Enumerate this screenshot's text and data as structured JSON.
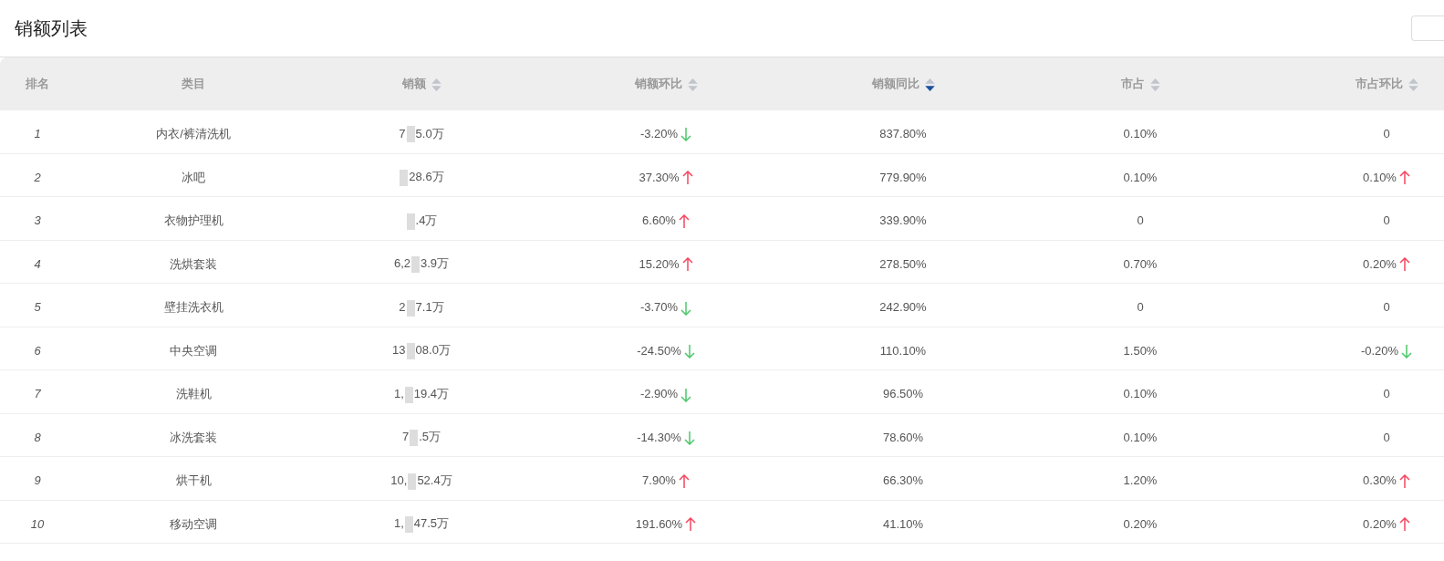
{
  "title": "销额列表",
  "columns": [
    {
      "label": "排名",
      "kind": "plain"
    },
    {
      "label": "类目",
      "kind": "plain"
    },
    {
      "label": "销额",
      "kind": "sortable",
      "sorted": false
    },
    {
      "label": "销额环比",
      "kind": "sortable",
      "sorted": false
    },
    {
      "label": "销额同比",
      "kind": "sortable",
      "sorted": true
    },
    {
      "label": "市占",
      "kind": "sortable",
      "sorted": false
    },
    {
      "label": "市占环比",
      "kind": "sortable",
      "sorted": false
    }
  ],
  "rows": [
    {
      "rank": "1",
      "category": "内衣/裤清洗机",
      "sales_before": "7",
      "sales_after": "5.0万",
      "mom": {
        "text": "-3.20%",
        "kind": "down"
      },
      "yoy": "837.80%",
      "share": "0.10%",
      "share_mom": {
        "text": "0",
        "kind": "plain"
      }
    },
    {
      "rank": "2",
      "category": "冰吧",
      "sales_after": "28.6万",
      "mom": {
        "text": "37.30%",
        "kind": "up"
      },
      "yoy": "779.90%",
      "share": "0.10%",
      "share_mom": {
        "text": "0.10%",
        "kind": "up"
      }
    },
    {
      "rank": "3",
      "category": "衣物护理机",
      "sales_after": ".4万",
      "mom": {
        "text": "6.60%",
        "kind": "up"
      },
      "yoy": "339.90%",
      "share": "0",
      "share_mom": {
        "text": "0",
        "kind": "plain"
      }
    },
    {
      "rank": "4",
      "category": "洗烘套装",
      "sales_before": "6,2",
      "sales_after": "3.9万",
      "mom": {
        "text": "15.20%",
        "kind": "up"
      },
      "yoy": "278.50%",
      "share": "0.70%",
      "share_mom": {
        "text": "0.20%",
        "kind": "up"
      }
    },
    {
      "rank": "5",
      "category": "壁挂洗衣机",
      "sales_before": "2",
      "sales_after": "7.1万",
      "mom": {
        "text": "-3.70%",
        "kind": "down"
      },
      "yoy": "242.90%",
      "share": "0",
      "share_mom": {
        "text": "0",
        "kind": "plain"
      }
    },
    {
      "rank": "6",
      "category": "中央空调",
      "sales_before": "13",
      "sales_after": "08.0万",
      "mom": {
        "text": "-24.50%",
        "kind": "down"
      },
      "yoy": "110.10%",
      "share": "1.50%",
      "share_mom": {
        "text": "-0.20%",
        "kind": "down"
      }
    },
    {
      "rank": "7",
      "category": "洗鞋机",
      "sales_before": "1,",
      "sales_after": "19.4万",
      "mom": {
        "text": "-2.90%",
        "kind": "down"
      },
      "yoy": "96.50%",
      "share": "0.10%",
      "share_mom": {
        "text": "0",
        "kind": "plain"
      }
    },
    {
      "rank": "8",
      "category": "冰洗套装",
      "sales_before": "7",
      "sales_after": ".5万",
      "mom": {
        "text": "-14.30%",
        "kind": "down"
      },
      "yoy": "78.60%",
      "share": "0.10%",
      "share_mom": {
        "text": "0",
        "kind": "plain"
      }
    },
    {
      "rank": "9",
      "category": "烘干机",
      "sales_before": "10,",
      "sales_after": "52.4万",
      "mom": {
        "text": "7.90%",
        "kind": "up"
      },
      "yoy": "66.30%",
      "share": "1.20%",
      "share_mom": {
        "text": "0.30%",
        "kind": "up"
      }
    },
    {
      "rank": "10",
      "category": "移动空调",
      "sales_before": "1,",
      "sales_after": "47.5万",
      "mom": {
        "text": "191.60%",
        "kind": "up"
      },
      "yoy": "41.10%",
      "share": "0.20%",
      "share_mom": {
        "text": "0.20%",
        "kind": "up"
      }
    }
  ]
}
